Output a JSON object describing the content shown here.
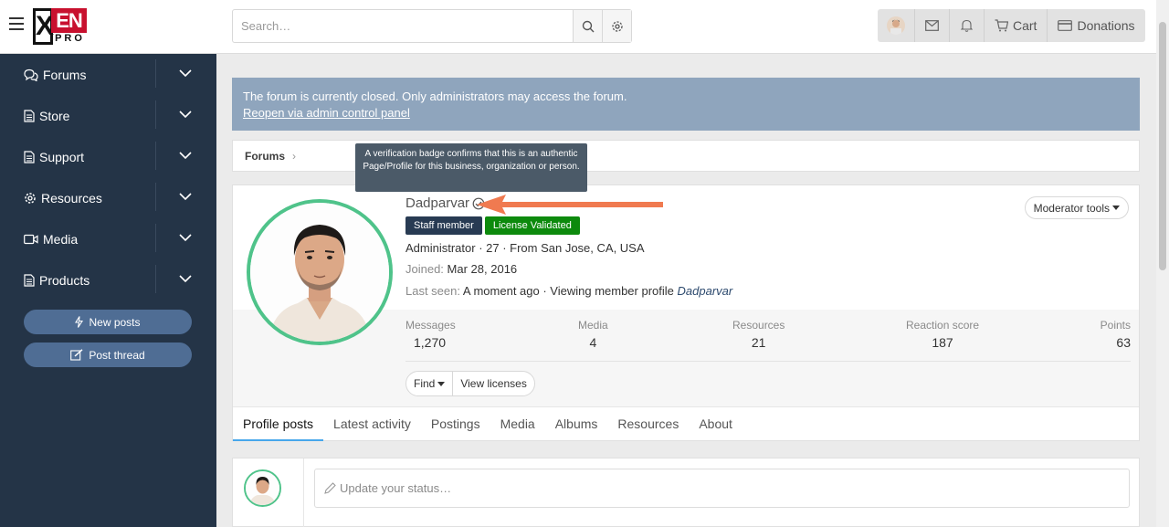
{
  "header": {
    "logo": {
      "x": "X",
      "en": "EN",
      "pro": "PRO"
    },
    "search_placeholder": "Search…",
    "nav": {
      "cart": "Cart",
      "donations": "Donations"
    }
  },
  "sidebar": {
    "items": [
      {
        "label": "Forums",
        "icon": "comments-icon"
      },
      {
        "label": "Store",
        "icon": "file-icon"
      },
      {
        "label": "Support",
        "icon": "file-icon"
      },
      {
        "label": "Resources",
        "icon": "gear-icon"
      },
      {
        "label": "Media",
        "icon": "video-camera-icon"
      },
      {
        "label": "Products",
        "icon": "file-icon"
      }
    ],
    "buttons": {
      "new_posts": "New posts",
      "post_thread": "Post thread"
    }
  },
  "notice": {
    "text": "The forum is currently closed. Only administrators may access the forum.",
    "link": "Reopen via admin control panel"
  },
  "breadcrumb": {
    "forums": "Forums"
  },
  "tooltip": "A verification badge confirms that this is an authentic Page/Profile for this business, organization or person.",
  "profile": {
    "username": "Dadparvar",
    "badges": {
      "staff": "Staff member",
      "license": "License Validated"
    },
    "info_line": "Administrator · 27 · From San Jose, CA, USA",
    "joined_label": "Joined:",
    "joined_value": "Mar 28, 2016",
    "last_seen_label": "Last seen:",
    "last_seen_value": "A moment ago · Viewing member profile",
    "last_seen_target": "Dadparvar",
    "moderator_tools": "Moderator tools",
    "stats": [
      {
        "label": "Messages",
        "value": "1,270"
      },
      {
        "label": "Media",
        "value": "4"
      },
      {
        "label": "Resources",
        "value": "21"
      },
      {
        "label": "Reaction score",
        "value": "187"
      },
      {
        "label": "Points",
        "value": "63"
      }
    ],
    "actions": {
      "find": "Find",
      "view_licenses": "View licenses"
    },
    "tabs": [
      "Profile posts",
      "Latest activity",
      "Postings",
      "Media",
      "Albums",
      "Resources",
      "About"
    ]
  },
  "status": {
    "placeholder": "Update your status…"
  },
  "colors": {
    "sidebar_bg": "#243447",
    "accent_button": "#4f6d94",
    "notice_bg": "#8fa5bd",
    "avatar_ring": "#4fc38a",
    "staff_badge": "#283b53",
    "license_badge": "#0d8a0d",
    "annotation_arrow": "#f07a50"
  }
}
